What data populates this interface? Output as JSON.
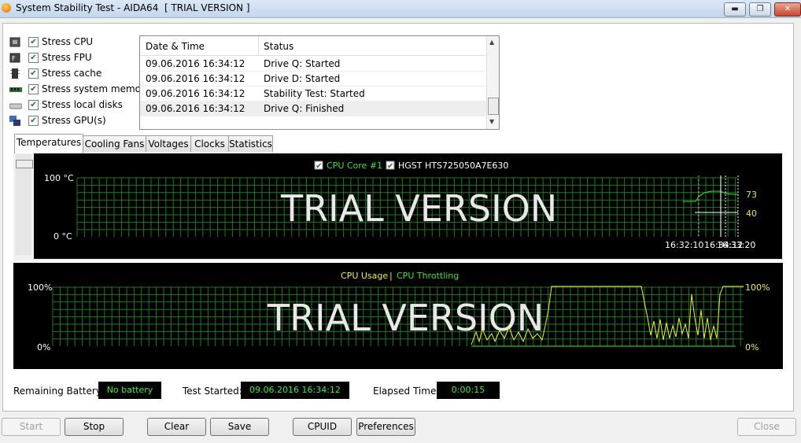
{
  "window": {
    "title": "System Stability Test - AIDA64  [ TRIAL VERSION ]",
    "min_glyph": "▬",
    "max_glyph": "❐",
    "close_glyph": "✕"
  },
  "stress": [
    {
      "label": "Stress CPU",
      "checked": true,
      "icon": "cpu-icon"
    },
    {
      "label": "Stress FPU",
      "checked": true,
      "icon": "fpu-icon"
    },
    {
      "label": "Stress cache",
      "checked": true,
      "icon": "cache-icon"
    },
    {
      "label": "Stress system memory",
      "checked": true,
      "icon": "memory-icon"
    },
    {
      "label": "Stress local disks",
      "checked": true,
      "icon": "disk-icon"
    },
    {
      "label": "Stress GPU(s)",
      "checked": true,
      "icon": "gpu-icon"
    }
  ],
  "log": {
    "col_date": "Date & Time",
    "col_status": "Status",
    "rows": [
      {
        "date": "09.06.2016 16:34:12",
        "status": "Drive Q: Started"
      },
      {
        "date": "09.06.2016 16:34:12",
        "status": "Drive D: Started"
      },
      {
        "date": "09.06.2016 16:34:12",
        "status": "Stability Test: Started"
      },
      {
        "date": "09.06.2016 16:34:12",
        "status": "Drive Q: Finished"
      }
    ]
  },
  "tabs": [
    "Temperatures",
    "Cooling Fans",
    "Voltages",
    "Clocks",
    "Statistics"
  ],
  "active_tab": "Temperatures",
  "temp_graph": {
    "legend_1": "CPU Core #1",
    "legend_2": "HGST HTS725050A7E630",
    "y_top": "100 °C",
    "y_bottom": "0 °C",
    "watermark": "TRIAL VERSION",
    "value_1": "73",
    "value_2": "40",
    "time_1": "16:32:10",
    "time_2": "16:34:12",
    "time_3": "16:33:20",
    "colors": {
      "grid": "#1f7a1f",
      "cpu": "#3de03d",
      "disk": "#ffffff",
      "label": "#e6e647"
    }
  },
  "usage_graph": {
    "legend_1": "CPU Usage",
    "legend_sep": "|",
    "legend_2": "CPU Throttling",
    "y_top": "100%",
    "y_bottom": "0%",
    "y_top_right": "100%",
    "y_bottom_right": "0%",
    "watermark": "TRIAL VERSION",
    "colors": {
      "usage": "#f0f03c",
      "throttling": "#3de03d"
    }
  },
  "status": {
    "battery_label": "Remaining Battery:",
    "battery_value": "No battery",
    "started_label": "Test Started:",
    "started_value": "09.06.2016 16:34:12",
    "elapsed_label": "Elapsed Time:",
    "elapsed_value": "0:00:15"
  },
  "buttons": {
    "start": "Start",
    "stop": "Stop",
    "clear": "Clear",
    "save": "Save",
    "cpuid": "CPUID",
    "preferences": "Preferences",
    "close": "Close"
  }
}
